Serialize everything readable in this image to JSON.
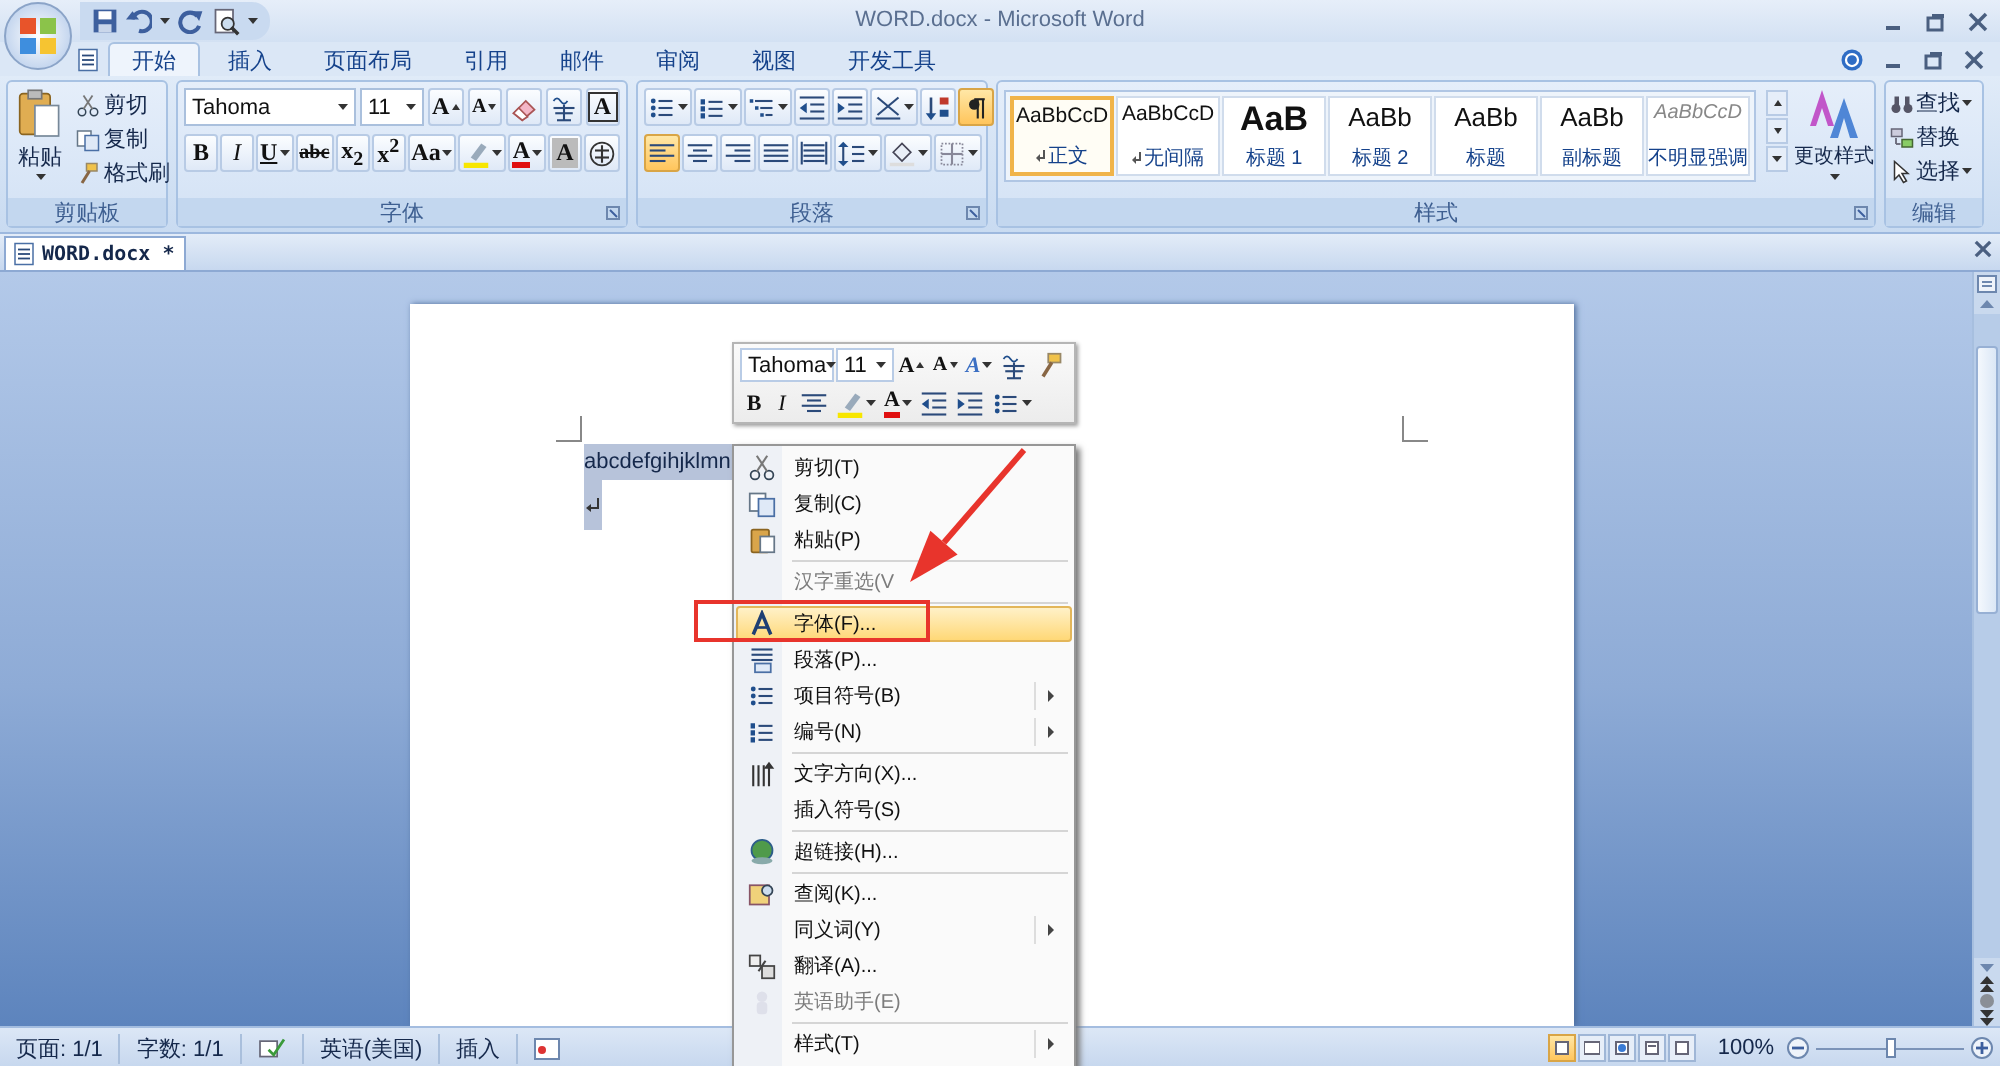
{
  "window": {
    "title": "WORD.docx - Microsoft Word"
  },
  "ribbon_tabs": [
    {
      "label": "开始",
      "selected": true
    },
    {
      "label": "插入",
      "selected": false
    },
    {
      "label": "页面布局",
      "selected": false
    },
    {
      "label": "引用",
      "selected": false
    },
    {
      "label": "邮件",
      "selected": false
    },
    {
      "label": "审阅",
      "selected": false
    },
    {
      "label": "视图",
      "selected": false
    },
    {
      "label": "开发工具",
      "selected": false
    }
  ],
  "clipboard": {
    "title": "剪贴板",
    "paste": "粘贴",
    "tools": [
      {
        "kind": "cut",
        "label": "剪切"
      },
      {
        "kind": "copy",
        "label": "复制"
      },
      {
        "kind": "painter",
        "label": "格式刷"
      }
    ]
  },
  "font": {
    "title": "字体",
    "font_name": "Tahoma",
    "font_size": "11",
    "row_1": [
      {
        "kind": "grow",
        "label": "A"
      },
      {
        "kind": "shrink",
        "label": "A"
      },
      {
        "kind": "clear"
      },
      {
        "kind": "phonetic"
      },
      {
        "kind": "border",
        "label": "A"
      }
    ],
    "row_2": [
      {
        "kind": "bold",
        "label": "B"
      },
      {
        "kind": "italic",
        "label": "I"
      },
      {
        "kind": "underline",
        "label": "U",
        "dropdown": true
      },
      {
        "kind": "strike",
        "label": "abc"
      },
      {
        "kind": "subscript",
        "label": "x$_{2}$"
      },
      {
        "kind": "superscript",
        "label": "x$^{2}$"
      },
      {
        "kind": "case",
        "label": "Aa",
        "dropdown": true
      },
      {
        "kind": "highlight",
        "dropdown": true
      },
      {
        "kind": "color",
        "label": "A",
        "dropdown": true
      },
      {
        "kind": "shading",
        "label": "A"
      },
      {
        "kind": "enclose"
      }
    ]
  },
  "paragraph": {
    "title": "段落",
    "row_1": [
      {
        "kind": "bullets",
        "dropdown": true,
        "selected": false
      },
      {
        "kind": "numbering",
        "dropdown": true,
        "selected": false
      },
      {
        "kind": "multilevel",
        "dropdown": true,
        "selected": false
      },
      {
        "kind": "outdent",
        "selected": false
      },
      {
        "kind": "indent",
        "selected": false
      },
      {
        "kind": "asian",
        "dropdown": true,
        "selected": false
      },
      {
        "kind": "sort",
        "selected": false
      },
      {
        "kind": "marks",
        "selected": true
      }
    ],
    "row_2": [
      {
        "kind": "align_left",
        "selected": true
      },
      {
        "kind": "align_center",
        "selected": false
      },
      {
        "kind": "align_right",
        "selected": false
      },
      {
        "kind": "justify",
        "selected": false
      },
      {
        "kind": "distributed",
        "selected": false
      },
      {
        "kind": "line_spacing",
        "dropdown": true,
        "selected": false
      },
      {
        "kind": "bucket",
        "dropdown": true,
        "selected": false
      },
      {
        "kind": "borders",
        "dropdown": true,
        "selected": false
      }
    ]
  },
  "styles": {
    "title": "样式",
    "change_styles": "更改样式",
    "gallery": [
      {
        "kind": "normal",
        "sample": "AaBbCcD",
        "name": "正文",
        "selected": true,
        "paragraph_style": true
      },
      {
        "kind": "no_spacing",
        "sample": "AaBbCcD",
        "name": "无间隔",
        "selected": false,
        "paragraph_style": true
      },
      {
        "kind": "heading1",
        "sample": "AaB",
        "name": "标题 1",
        "selected": false,
        "paragraph_style": false
      },
      {
        "kind": "heading2",
        "sample": "AaBb",
        "name": "标题 2",
        "selected": false,
        "paragraph_style": false
      },
      {
        "kind": "title",
        "sample": "AaBb",
        "name": "标题",
        "selected": false,
        "paragraph_style": false
      },
      {
        "kind": "subtitle",
        "sample": "AaBb",
        "name": "副标题",
        "selected": false,
        "paragraph_style": false
      },
      {
        "kind": "subtle",
        "sample": "AaBbCcD",
        "name": "不明显强调",
        "selected": false,
        "paragraph_style": false
      }
    ]
  },
  "editing": {
    "title": "编辑",
    "tools": [
      {
        "kind": "find",
        "label": "查找",
        "dropdown": true
      },
      {
        "kind": "replace",
        "label": "替换"
      },
      {
        "kind": "select",
        "label": "选择",
        "dropdown": true
      }
    ]
  },
  "doc_tab": {
    "label": "WORD.docx *"
  },
  "document": {
    "text": "abcdefgihjklmn",
    "selected": true
  },
  "mini_toolbar": {
    "font_name": "Tahoma",
    "font_size": "11",
    "row_1": [
      {
        "kind": "grow",
        "label": "A"
      },
      {
        "kind": "shrink",
        "label": "A"
      },
      {
        "kind": "styles",
        "label": "A",
        "dropdown": true
      },
      {
        "kind": "phonetic"
      },
      {
        "kind": "painter"
      }
    ],
    "row_2": [
      {
        "kind": "bold",
        "label": "B"
      },
      {
        "kind": "italic",
        "label": "I"
      },
      {
        "kind": "align_center"
      },
      {
        "kind": "highlight",
        "dropdown": true
      },
      {
        "kind": "color",
        "label": "A",
        "dropdown": true
      },
      {
        "kind": "outdent"
      },
      {
        "kind": "indent"
      },
      {
        "kind": "bullets",
        "dropdown": true
      }
    ]
  },
  "context_menu": {
    "items": [
      {
        "kind": "item",
        "label": "剪切(T)",
        "disabled": false,
        "selected": false,
        "submenu": false
      },
      {
        "kind": "item",
        "label": "复制(C)",
        "disabled": false,
        "selected": false,
        "submenu": false
      },
      {
        "kind": "item",
        "label": "粘贴(P)",
        "disabled": false,
        "selected": false,
        "submenu": false
      },
      {
        "kind": "separator"
      },
      {
        "kind": "item",
        "label": "汉字重选(V",
        "disabled": true,
        "selected": false,
        "submenu": false
      },
      {
        "kind": "separator"
      },
      {
        "kind": "item",
        "label": "字体(F)...",
        "disabled": false,
        "selected": true,
        "submenu": false
      },
      {
        "kind": "item",
        "label": "段落(P)...",
        "disabled": false,
        "selected": false,
        "submenu": false
      },
      {
        "kind": "item",
        "label": "项目符号(B)",
        "disabled": false,
        "selected": false,
        "submenu": true
      },
      {
        "kind": "item",
        "label": "编号(N)",
        "disabled": false,
        "selected": false,
        "submenu": true
      },
      {
        "kind": "separator"
      },
      {
        "kind": "item",
        "label": "文字方向(X)...",
        "disabled": false,
        "selected": false,
        "submenu": false
      },
      {
        "kind": "item",
        "label": "插入符号(S)",
        "disabled": false,
        "selected": false,
        "submenu": false
      },
      {
        "kind": "separator"
      },
      {
        "kind": "item",
        "label": "超链接(H)...",
        "disabled": false,
        "selected": false,
        "submenu": false
      },
      {
        "kind": "separator"
      },
      {
        "kind": "item",
        "label": "查阅(K)...",
        "disabled": false,
        "selected": false,
        "submenu": false
      },
      {
        "kind": "item",
        "label": "同义词(Y)",
        "disabled": false,
        "selected": false,
        "submenu": true
      },
      {
        "kind": "item",
        "label": "翻译(A)...",
        "disabled": false,
        "selected": false,
        "submenu": false
      },
      {
        "kind": "item",
        "label": "英语助手(E)",
        "disabled": true,
        "selected": false,
        "submenu": false
      },
      {
        "kind": "separator"
      },
      {
        "kind": "item",
        "label": "样式(T)",
        "disabled": false,
        "selected": false,
        "submenu": true
      }
    ]
  },
  "status_bar": {
    "page": "页面: 1/1",
    "words": "字数: 1/1",
    "language": "英语(美国)",
    "mode": "插入",
    "zoom": "100%",
    "zoom_slider": {
      "level": 0.5
    },
    "views": [
      {
        "kind": "print",
        "selected": true
      },
      {
        "kind": "reading",
        "selected": false
      },
      {
        "kind": "web",
        "selected": false
      },
      {
        "kind": "outline",
        "selected": false
      },
      {
        "kind": "draft",
        "selected": false
      }
    ]
  }
}
